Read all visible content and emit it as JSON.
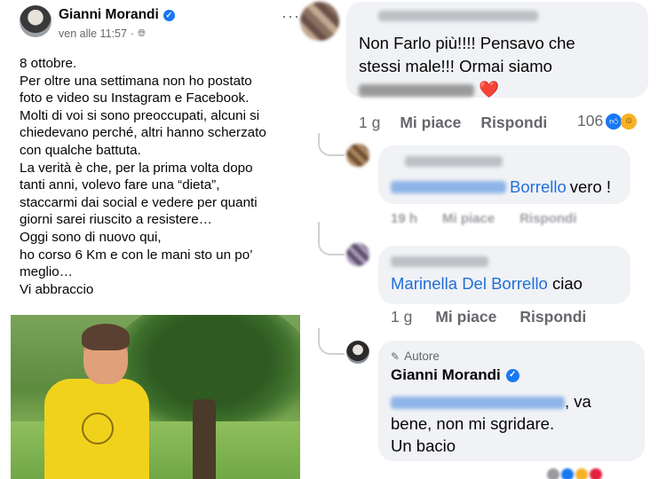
{
  "post": {
    "author": "Gianni Morandi",
    "time": "ven alle 11:57",
    "separator": "·",
    "audience_icon": "globe-icon",
    "more_icon": "more-options-icon",
    "lines": [
      "8 ottobre.",
      "Per oltre una settimana non ho postato",
      "foto e video su Instagram e Facebook.",
      "Molti di voi si sono preoccupati, alcuni si",
      "chiedevano perché, altri hanno scherzato",
      "con qualche battuta.",
      "La verità è che, per la prima volta dopo",
      "tanti anni, volevo fare una “dieta”,",
      "staccarmi dai social e vedere per quanti",
      "giorni sarei riuscito a resistere…",
      "Oggi sono di nuovo qui,",
      "ho corso 6 Km e con le mani sto un po’",
      "meglio…",
      "Vi abbraccio"
    ]
  },
  "comments": {
    "c1": {
      "line1": "Non Farlo più!!!! Pensavo che",
      "line2": "stessi male!!!  Ormai siamo",
      "line3": "diventati",
      "heart": "❤️",
      "time": "1 g",
      "like": "Mi piace",
      "reply": "Rispondi",
      "reaction_count": "106"
    },
    "c2": {
      "link_suffix": "Borrello",
      "text": "vero !",
      "time": "19 h",
      "like": "Mi piace",
      "reply": "Rispondi"
    },
    "c3": {
      "link": "Marinella Del Borrello",
      "text": "ciao",
      "time": "1 g",
      "like": "Mi piace",
      "reply": "Rispondi"
    },
    "c4": {
      "badge": "Autore",
      "name": "Gianni Morandi",
      "text_end": ", va",
      "line2": "bene, non mi sgridare.",
      "line3": "Un bacio"
    }
  },
  "colors": {
    "link": "#216fdb",
    "verified": "#1877f2",
    "bubble": "#f0f2f5",
    "secondary_text": "#65676b"
  }
}
